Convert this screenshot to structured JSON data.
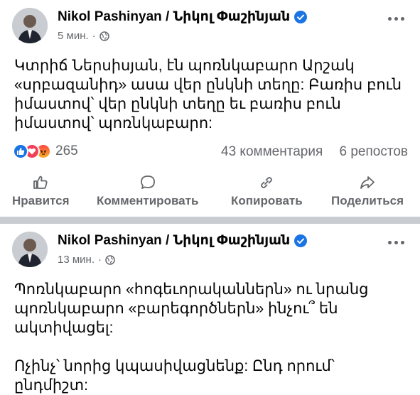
{
  "posts": [
    {
      "author": "Nikol Pashinyan / Նիկոլ Փաշինյան",
      "time": "5 мин.",
      "text": "Կտրիճ Ներսիսյան, էն պոռնկաբարո Արշակ «սրբազանիդ» ասա վեր ընկնի տեղը: Բառիս բուն իմաստով՝ վեր ընկնի տեղը եւ բառիս բուն իմաստով՝ պոռնկաբարո:",
      "reaction_count": "265",
      "comments": "43 комментария",
      "shares": "6 репостов",
      "actions": {
        "like": "Нравится",
        "comment": "Комментировать",
        "copy": "Копировать",
        "share": "Поделиться"
      }
    },
    {
      "author": "Nikol Pashinyan / Նիկոլ Փաշինյան",
      "time": "13 мин.",
      "text": "Պոռնկաբարո «հոգեւորականներն» ու նրանց պոռնկաբարո «բարեգործներն» ինչու՞ են ակտիվացել:\n\nՈչինչ՝ նորից կպասիվացնենք: Ընդ որում՝ ընդմիշտ:"
    }
  ],
  "colors": {
    "accent": "#1b74e4",
    "secondary_text": "#65676b",
    "divider": "#c9ccd1"
  },
  "icons": {
    "verified": "verified-badge-icon",
    "audience": "globe-icon",
    "more": "more-dots-icon",
    "like": "thumbs-up-icon",
    "comment": "comment-bubble-icon",
    "copy": "link-icon",
    "share": "share-arrow-icon"
  }
}
